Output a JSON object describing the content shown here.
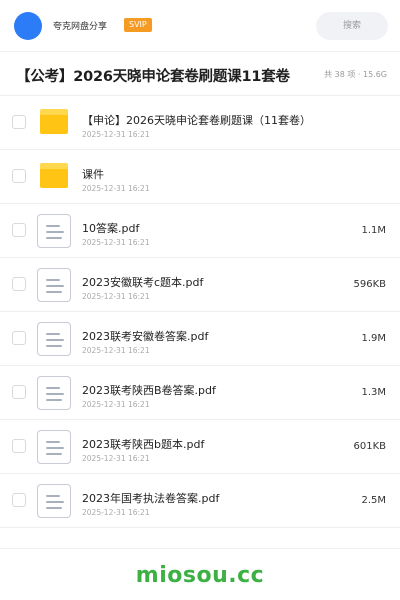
{
  "header": {
    "username": "夸克网盘分享",
    "badge": "SVIP",
    "search_placeholder": "搜索"
  },
  "folder": {
    "title": "【公考】2026天晓申论套卷刷题课11套卷",
    "meta": "共 38 项 · 15.6G"
  },
  "items": [
    {
      "type": "folder",
      "name": "【申论】2026天晓申论套卷刷题课（11套卷）",
      "date": "2025-12-31 16:21",
      "size": ""
    },
    {
      "type": "folder",
      "name": "课件",
      "date": "2025-12-31 16:21",
      "size": ""
    },
    {
      "type": "file",
      "name": "10答案.pdf",
      "date": "2025-12-31 16:21",
      "size": "1.1M"
    },
    {
      "type": "file",
      "name": "2023安徽联考c题本.pdf",
      "date": "2025-12-31 16:21",
      "size": "596KB"
    },
    {
      "type": "file",
      "name": "2023联考安徽卷答案.pdf",
      "date": "2025-12-31 16:21",
      "size": "1.9M"
    },
    {
      "type": "file",
      "name": "2023联考陕西B卷答案.pdf",
      "date": "2025-12-31 16:21",
      "size": "1.3M"
    },
    {
      "type": "file",
      "name": "2023联考陕西b题本.pdf",
      "date": "2025-12-31 16:21",
      "size": "601KB"
    },
    {
      "type": "file",
      "name": "2023年国考执法卷答案.pdf",
      "date": "2025-12-31 16:21",
      "size": "2.5M"
    }
  ],
  "watermark": "miosou.cc",
  "colors": {
    "avatar": "#2b7cf6",
    "badge": "#f59a23",
    "folder": "#ffc414",
    "watermark": "#3cb043"
  },
  "icons": {
    "folder": "folder-icon",
    "file": "pdf-file-icon"
  }
}
